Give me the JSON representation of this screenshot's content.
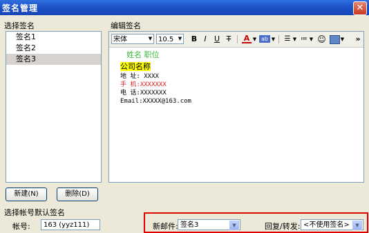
{
  "window": {
    "title": "签名管理",
    "close": "✕"
  },
  "left": {
    "label": "选择签名",
    "items": [
      "签名1",
      "签名2",
      "签名3"
    ],
    "new_button": "新建(N)",
    "delete_button": "删除(D)"
  },
  "editor": {
    "label": "编辑签名",
    "font": "宋体",
    "size": "10.5",
    "toolbar": {
      "bold": "B",
      "italic": "I",
      "underline": "U",
      "strike": "T",
      "more": "»"
    },
    "lines": {
      "name_title": "姓名 职位",
      "company": "公司名称",
      "address": "地 址: XXXX",
      "mobile": "手 机:XXXXXXX",
      "phone": "电 话:XXXXXXX",
      "email": "Email:XXXXX@163.com"
    }
  },
  "bottom": {
    "label": "选择帐号默认签名",
    "account_label": "帐号:",
    "account_value": "163 (yyz111)",
    "new_mail_label": "新邮件:",
    "new_mail_value": "签名3",
    "reply_label": "回复/转发:",
    "reply_value": "<不使用签名>"
  },
  "colors": {
    "highlight": "#ffff00",
    "green": "#3cb83c",
    "red": "#e02020",
    "accent_box": "#e00000"
  }
}
